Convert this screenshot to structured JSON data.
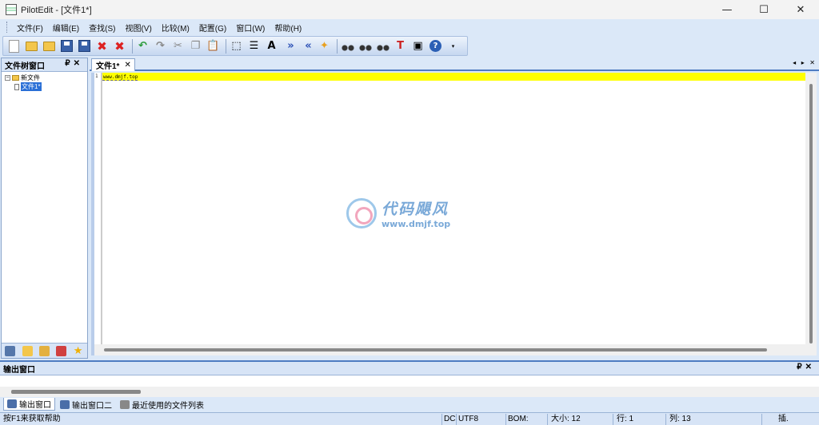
{
  "window": {
    "title": "PilotEdit - [文件1*]",
    "controls": {
      "minimize": "—",
      "maximize": "☐",
      "close": "✕"
    }
  },
  "menu": [
    "文件(F)",
    "编辑(E)",
    "查找(S)",
    "视图(V)",
    "比较(M)",
    "配置(G)",
    "窗口(W)",
    "帮助(H)"
  ],
  "toolbar": {
    "font_glyph": "A",
    "help_glyph": "?"
  },
  "left_panel": {
    "title": "文件树窗口",
    "pin_glyph": "₽",
    "close_glyph": "✕",
    "tree": {
      "root_label": "新文件",
      "child_label": "文件1*"
    }
  },
  "editor": {
    "tab_label": "文件1*",
    "tab_close": "✕",
    "tab_nav": "◂ ▸ ✕",
    "line_number": "1",
    "line_text": "www.dmjf.top"
  },
  "watermark": {
    "name": "代码飓风",
    "url": "www.dmjf.top"
  },
  "output_panel": {
    "title": "输出窗口",
    "pin_glyph": "₽",
    "close_glyph": "✕",
    "tabs": [
      "输出窗口",
      "输出窗口二",
      "最近使用的文件列表"
    ]
  },
  "status": {
    "help": "按F1来获取帮助",
    "line_ending": "DC",
    "encoding": "UTF8",
    "bom": "BOM:",
    "size": "大小: 12",
    "row": "行: 1",
    "col": "列: 13",
    "insert": "插."
  }
}
